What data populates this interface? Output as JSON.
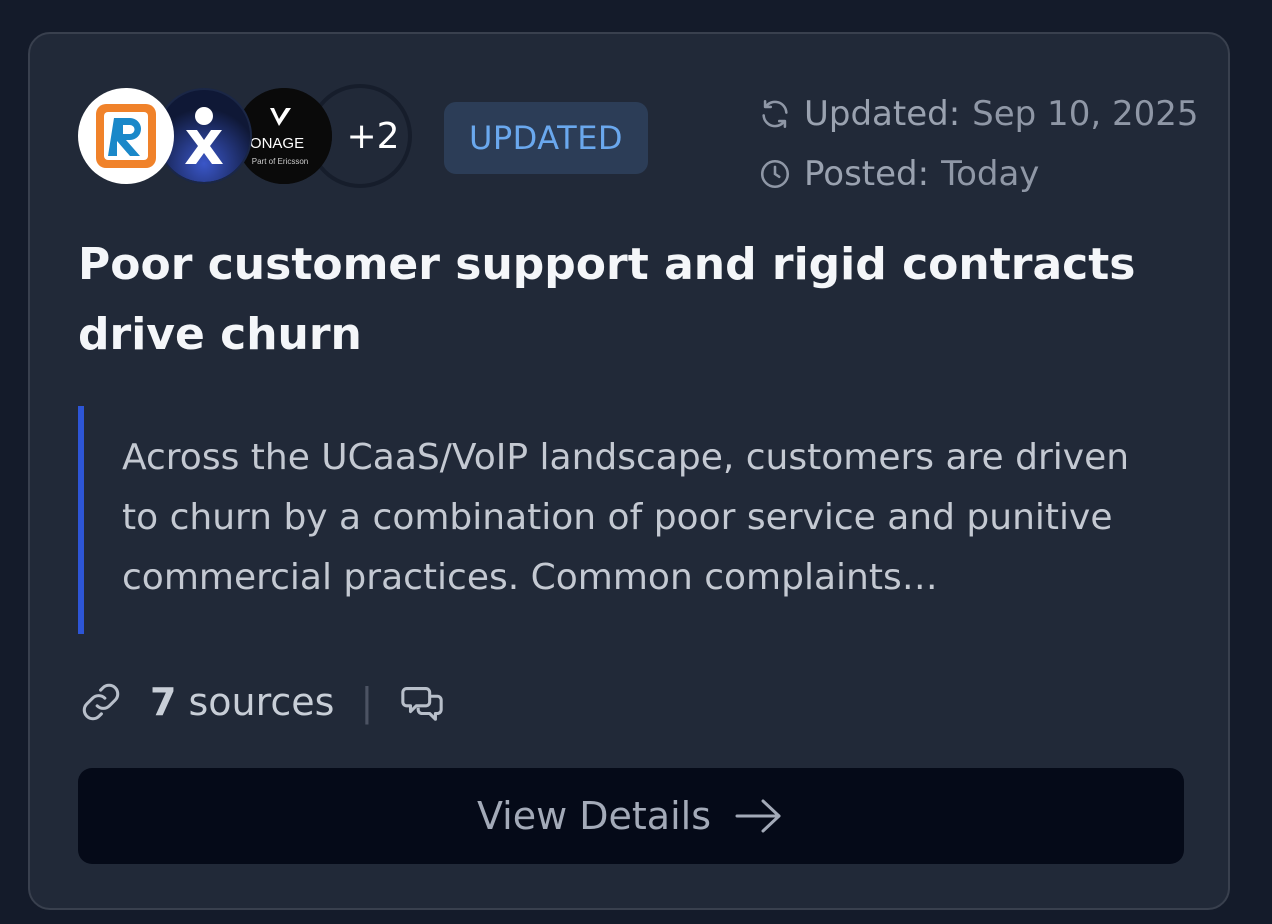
{
  "card": {
    "logos": [
      {
        "name": "R logo"
      },
      {
        "name": "X logo"
      },
      {
        "name": "Vonage logo",
        "text": "VONAGE",
        "subtext": "Part of Ericsson"
      }
    ],
    "more_count": "+2",
    "badge": "UPDATED",
    "updated": {
      "label": "Updated:",
      "value": "Sep 10, 2025"
    },
    "posted": {
      "label": "Posted:",
      "value": "Today"
    },
    "title": "Poor customer support and rigid contracts drive churn",
    "excerpt": "Across the UCaaS/VoIP landscape, customers are driven to churn by a combination of poor service and punitive commercial practices. Common complaints…",
    "sources_count": "7",
    "sources_label": "sources",
    "separator": "|",
    "button_label": "View Details"
  },
  "colors": {
    "background": "#141b2a",
    "card": "#212938",
    "badge_bg": "#2c3d57",
    "badge_text": "#6aa8ee",
    "quote_bar": "#2d55d6",
    "button_bg": "#050a18"
  },
  "icons": [
    "refresh-icon",
    "clock-icon",
    "link-icon",
    "chat-icon",
    "arrow-right-icon"
  ]
}
